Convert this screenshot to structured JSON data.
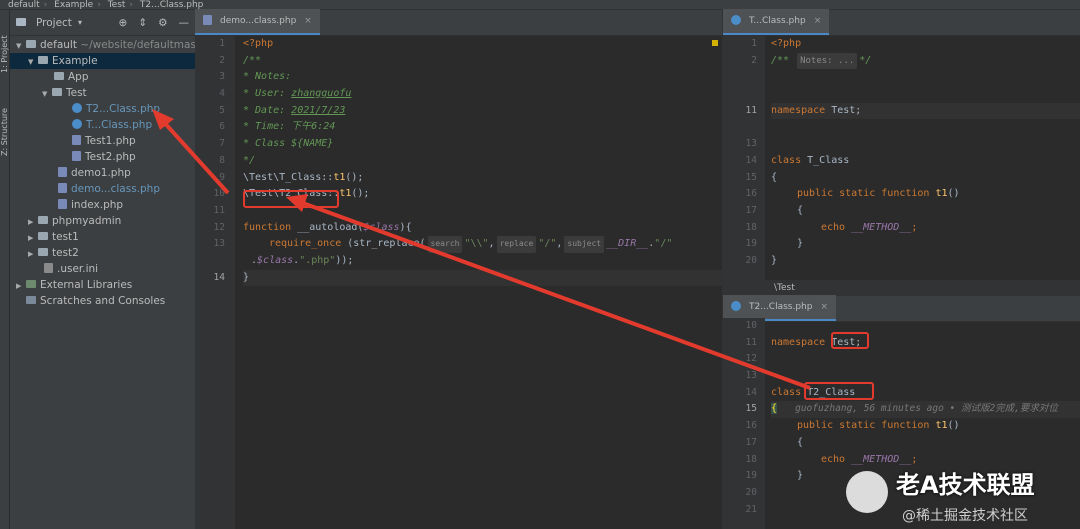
{
  "breadcrumb": [
    "default",
    "Example",
    "Test",
    "T2...Class.php"
  ],
  "toolwindow": {
    "project_label": "1: Project",
    "structure_label": "Z: Structure"
  },
  "project": {
    "title": "Project",
    "root_name": "default",
    "root_path": "~/website/defaultmas",
    "items": [
      "Example",
      "App",
      "Test",
      "T2...Class.php",
      "T...Class.php",
      "Test1.php",
      "Test2.php",
      "demo1.php",
      "demo...class.php",
      "index.php",
      "phpmyadmin",
      "test1",
      "test2",
      ".user.ini",
      "External Libraries",
      "Scratches and Consoles"
    ]
  },
  "editor_left": {
    "tab": "demo...class.php",
    "line_numbers": [
      "1",
      "2",
      "3",
      "4",
      "5",
      "6",
      "7",
      "8",
      "9",
      "10",
      "11",
      "12",
      "13",
      "",
      "14"
    ],
    "lines": {
      "l1": "<?php",
      "l2": "/**",
      "l3": " * Notes:",
      "l4a": " * User: ",
      "l4b": "zhangguofu",
      "l5a": " * Date: ",
      "l5b": "2021/7/23",
      "l6a": " * Time: ",
      "l6b": "下午6:24",
      "l7": " * Class ${NAME}",
      "l8": " */",
      "l9a": "\\Test\\",
      "l9b": "T_Class",
      "l9c": "::",
      "l9d": "t1",
      "l9e": "();",
      "l10a": "\\Test\\",
      "l10b": "T2_Class",
      "l10c": "::",
      "l10d": "t1",
      "l10e": "();",
      "l12a": "function",
      "l12b": " __autoload(",
      "l12c": "$class",
      "l12d": "){",
      "l13a": "require_once",
      "l13b": " (str_replace(",
      "l13h1": "search",
      "l13s1": "\"\\\\\"",
      "l13h2": "replace",
      "l13s2": "\"/\"",
      "l13h3": "subject",
      "l13c": "__DIR__",
      "l13d": ".",
      "l13s3": "\"/\"",
      "l13e": ".",
      "l13f": "$class",
      "l13g": ".",
      "l13s4": "\".php\"",
      "l13i": "));",
      "l14": "}"
    }
  },
  "editor_top_right": {
    "tab": "T...Class.php",
    "line_numbers": [
      "1",
      "2",
      "",
      "",
      "11",
      "",
      "13",
      "14",
      "15",
      "16",
      "17",
      "18",
      "19",
      "20"
    ],
    "lines": {
      "l1": "<?php",
      "l2a": "/**",
      "l2b": "Notes: ...",
      "l2c": "*/",
      "l11a": "namespace",
      "l11b": " Test;",
      "l14a": "class",
      "l14b": " T_Class",
      "l15": "{",
      "l16a": "public static function",
      "l16b": " t1",
      "l16c": "()",
      "l17": "{",
      "l18a": "echo",
      "l18b": " __METHOD__",
      "l18c": ";",
      "l19": "}",
      "l20": "}"
    }
  },
  "namespace_strip": "\\Test",
  "editor_bottom_right": {
    "tab": "T2...Class.php",
    "line_numbers": [
      "10",
      "11",
      "12",
      "13",
      "14",
      "15",
      "16",
      "17",
      "18",
      "19",
      "20",
      "21"
    ],
    "lines": {
      "l11a": "namespace",
      "l11b": " Test;",
      "l14a": "class",
      "l14b": " T2_Class",
      "l15a": "{",
      "l15b": "guofuzhang, 56 minutes ago • 测试版2完成,要求对位",
      "l16a": "public static function",
      "l16b": " t1",
      "l16c": "()",
      "l17": "{",
      "l18a": "echo",
      "l18b": " __METHOD__",
      "l18c": ";",
      "l19": "}"
    }
  },
  "watermark": {
    "title": "老A技术联盟",
    "subtitle": "@稀土掘金技术社区"
  },
  "colors": {
    "annotation": "#e23b2e",
    "keyword": "#cc7832",
    "comment": "#629755",
    "string": "#6a8759"
  }
}
